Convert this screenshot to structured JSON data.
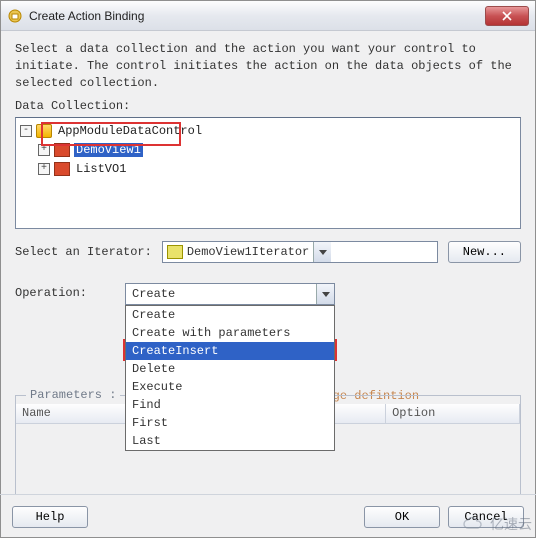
{
  "title": "Create Action Binding",
  "desc": "Select a data collection and the action you want your control to initiate. The control initiates the action on the data objects of the selected collection.",
  "dataCollectionLabel": "Data Collection:",
  "tree": {
    "root": {
      "label": "AppModuleDataControl",
      "expander": "-"
    },
    "child1": {
      "label": "DemoView1",
      "expander": "+"
    },
    "child2": {
      "label": "ListVO1",
      "expander": "+"
    }
  },
  "iteratorLabel": "Select an Iterator:",
  "iteratorValue": "DemoView1Iterator",
  "newBtn": "New...",
  "operationLabel": "Operation:",
  "operationSelected": "Create",
  "operationOptions": [
    "Create",
    "Create with parameters",
    "CreateInsert",
    "Delete",
    "Execute",
    "Find",
    "First",
    "Last"
  ],
  "operationHighlightIndex": 2,
  "hint": "Apply to all iterators in page defintion",
  "paramsLabel": "Parameters :",
  "tableHeaders": {
    "name": "Name",
    "value": "",
    "option": "Option"
  },
  "footer": {
    "help": "Help",
    "ok": "OK",
    "cancel": "Cancel"
  },
  "watermark": "亿速云"
}
